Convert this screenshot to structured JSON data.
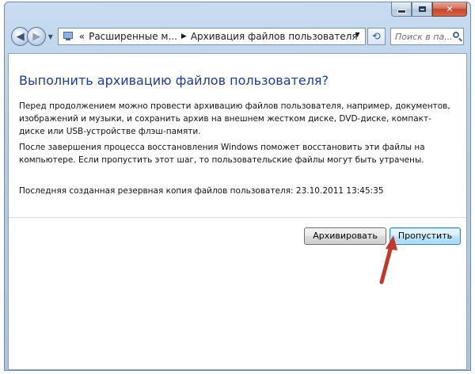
{
  "window": {
    "minimize_label": "",
    "maximize_label": "",
    "close_label": "✕"
  },
  "nav": {
    "back_icon": "back-arrow-icon",
    "forward_icon": "forward-arrow-icon",
    "address_chevrons": "«",
    "breadcrumb_1": "Расширенные м...",
    "breadcrumb_separator": "▶",
    "breadcrumb_2": "Архивация файлов пользователя",
    "search_placeholder": "Поиск в па..."
  },
  "content": {
    "heading": "Выполнить архивацию файлов пользователя?",
    "paragraph_1": "Перед продолжением можно провести архивацию файлов пользователя, например, документов, изображений и музыки, и сохранить архив на внешнем жестком диске, DVD-диске, компакт-диске или USB-устройстве флэш-памяти.",
    "paragraph_2": "После завершения процесса восстановления Windows поможет восстановить эти файлы на компьютере. Если пропустить этот шаг, то пользовательские файлы могут быть утрачены.",
    "last_backup": "Последняя созданная резервная копия файлов пользователя:  23.10.2011 13:45:35"
  },
  "buttons": {
    "archive_label": "Архивировать",
    "skip_label": "Пропустить"
  },
  "colors": {
    "heading": "#1e3c8c",
    "annotation_arrow": "#c0392b"
  }
}
